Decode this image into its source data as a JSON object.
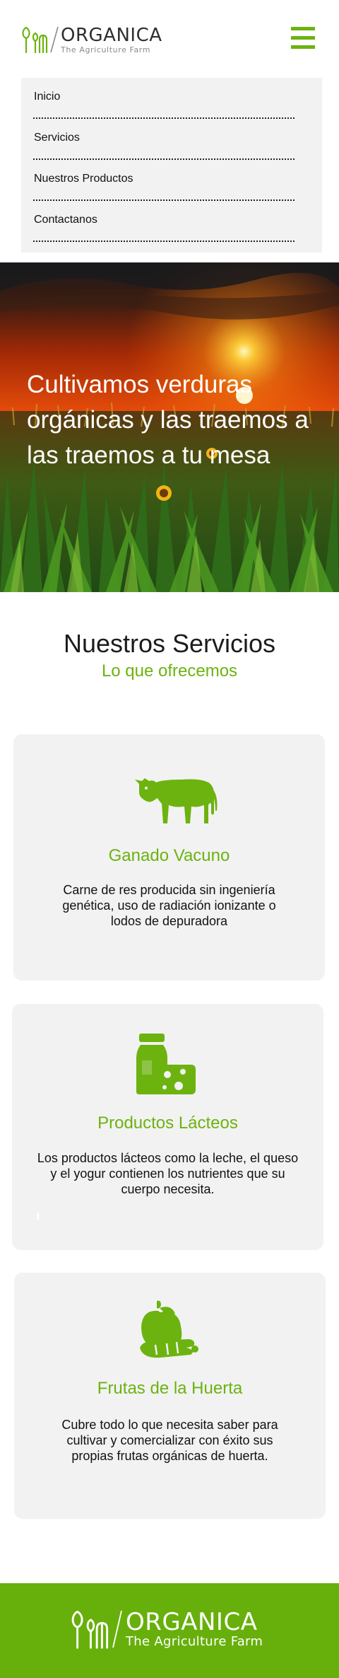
{
  "brand": {
    "name": "ORGANICA",
    "tagline": "The Agriculture Farm",
    "accent_color": "#6cb30f",
    "footer_color": "#67b00b"
  },
  "header": {
    "menu_icon": "hamburger-icon"
  },
  "nav": {
    "items": [
      {
        "label": "Inicio"
      },
      {
        "label": "Servicios"
      },
      {
        "label": "Nuestros Productos"
      },
      {
        "label": "Contactanos"
      }
    ]
  },
  "hero": {
    "headline": "Cultivamos verduras orgánicas y las traemos a las traemos a tu mesa"
  },
  "services": {
    "title": "Nuestros Servicios",
    "subtitle": "Lo que ofrecemos",
    "cards": [
      {
        "icon": "cow-icon",
        "title": "Ganado Vacuno",
        "text": "Carne de res producida sin ingeniería genética, uso de radiación ionizante o lodos de depuradora"
      },
      {
        "icon": "dairy-icon",
        "title": "Productos Lácteos",
        "text": "Los productos lácteos como la leche, el queso y el yogur contienen los nutrientes que su cuerpo necesita."
      },
      {
        "icon": "fruit-vegetable-icon",
        "title": "Frutas de la Huerta",
        "text": "Cubre todo lo que necesita saber para cultivar y comercializar con éxito sus propias frutas orgánicas de huerta."
      }
    ]
  },
  "footer": {
    "name": "ORGANICA",
    "tagline": "The Agriculture Farm"
  }
}
